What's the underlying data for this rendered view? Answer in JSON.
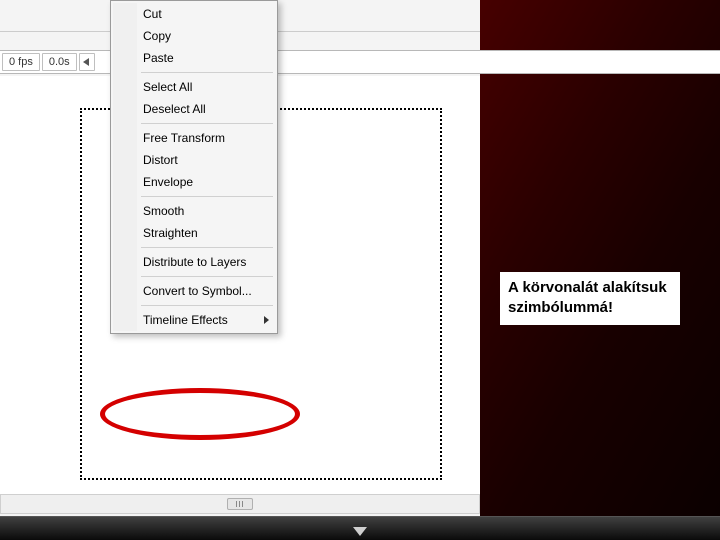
{
  "timeline": {
    "fps_label": "0 fps",
    "time_label": "0.0s"
  },
  "context_menu": {
    "cut": "Cut",
    "copy": "Copy",
    "paste": "Paste",
    "select_all": "Select All",
    "deselect_all": "Deselect All",
    "free_transform": "Free Transform",
    "distort": "Distort",
    "envelope": "Envelope",
    "smooth": "Smooth",
    "straighten": "Straighten",
    "distribute_to_layers": "Distribute to Layers",
    "convert_to_symbol": "Convert to Symbol...",
    "timeline_effects": "Timeline Effects"
  },
  "caption": {
    "text": "A körvonalát alakítsuk szimbólummá!"
  },
  "colors": {
    "highlight_ring": "#d40000"
  }
}
